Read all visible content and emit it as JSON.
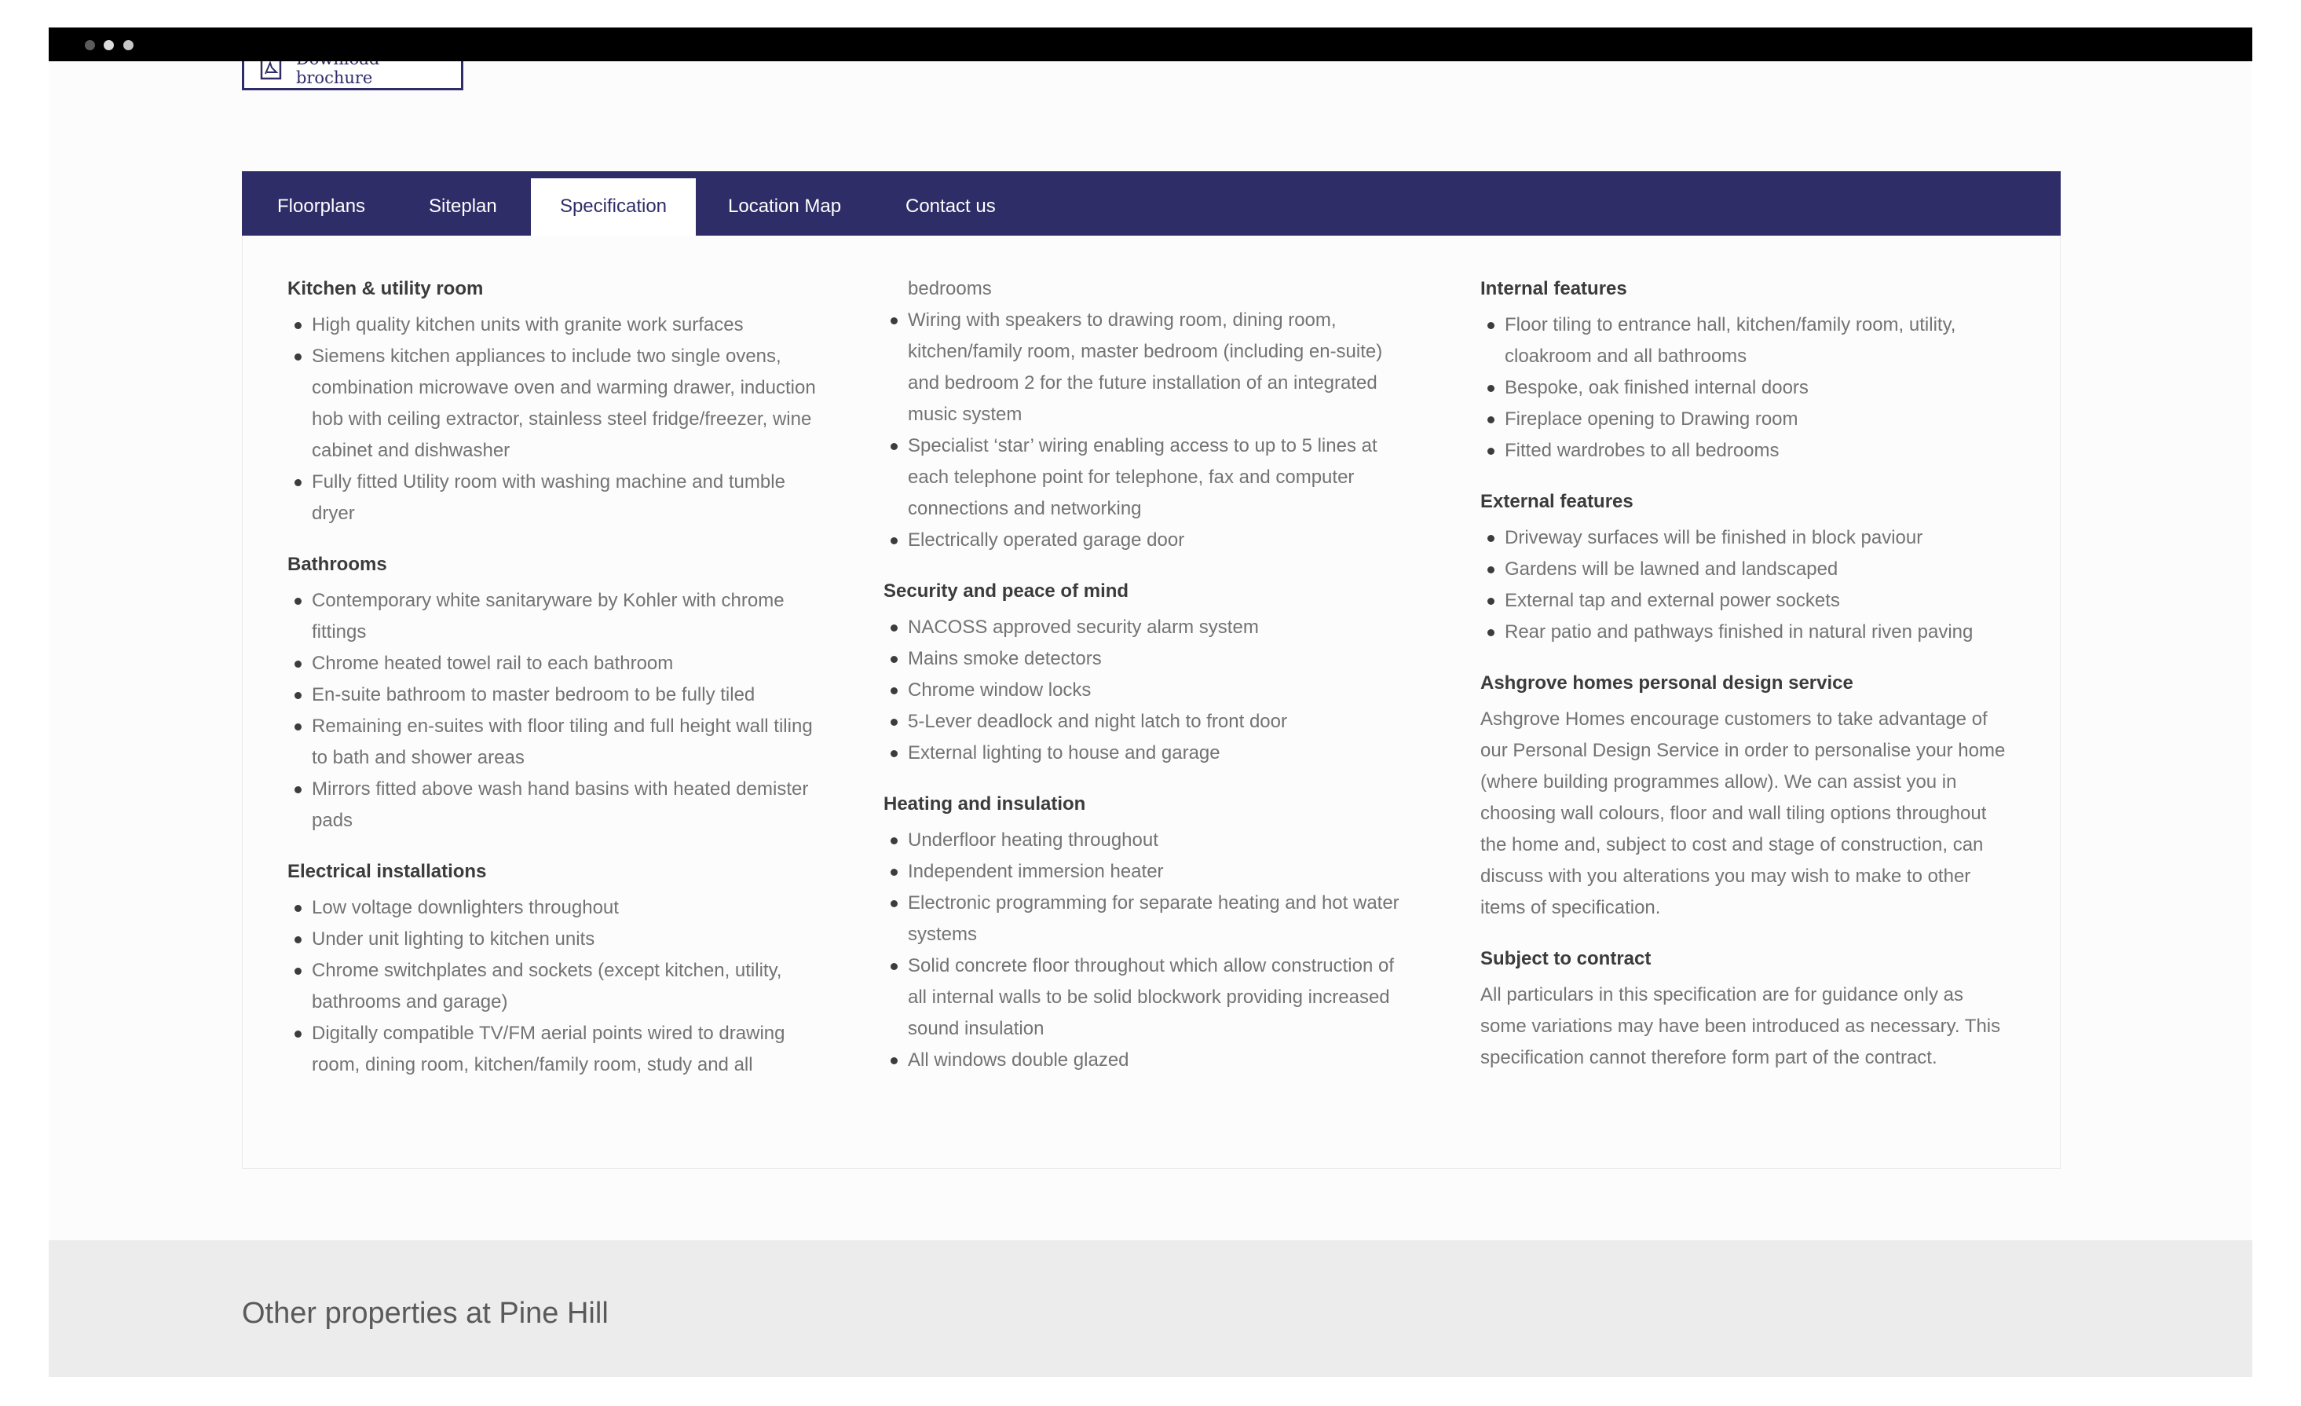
{
  "brochure": {
    "label": "Download brochure"
  },
  "top_cutoff_item": "Fitted wardrobes to all bedrooms",
  "tabs": [
    {
      "label": "Floorplans"
    },
    {
      "label": "Siteplan"
    },
    {
      "label": "Specification"
    },
    {
      "label": "Location Map"
    },
    {
      "label": "Contact us"
    }
  ],
  "active_tab": "Specification",
  "spec": {
    "kitchen": {
      "title": "Kitchen & utility room",
      "items": [
        "High quality kitchen units with granite work surfaces",
        "Siemens kitchen appliances to include two single ovens, combination microwave oven and warming drawer, induction hob with ceiling extractor, stainless steel fridge/freezer, wine cabinet and dishwasher",
        "Fully fitted Utility room with washing machine and tumble dryer"
      ]
    },
    "bathrooms": {
      "title": "Bathrooms",
      "items": [
        "Contemporary white sanitaryware by Kohler with chrome fittings",
        "Chrome heated towel rail to each bathroom",
        "En-suite bathroom to master bedroom to be fully tiled",
        "Remaining en-suites with floor tiling and full height wall tiling to bath and shower areas",
        "Mirrors fitted above wash hand basins with heated demister pads"
      ]
    },
    "electrical": {
      "title": "Electrical installations",
      "items": [
        "Low voltage downlighters throughout",
        "Under unit lighting to kitchen units",
        "Chrome switchplates and sockets (except kitchen, utility, bathrooms and garage)",
        "Digitally compatible TV/FM aerial points wired to drawing room, dining room, kitchen/family room, study and all"
      ],
      "continued": "bedrooms",
      "items_cont": [
        "Wiring with speakers to drawing room, dining room, kitchen/family room, master bedroom (including en-suite) and bedroom 2 for the future installation of an integrated music system",
        "Specialist ‘star’ wiring enabling access to up to 5 lines at each telephone point for telephone, fax and computer connections and networking",
        "Electrically operated garage door"
      ]
    },
    "security": {
      "title": "Security and peace of mind",
      "items": [
        "NACOSS approved security alarm system",
        "Mains smoke detectors",
        "Chrome window locks",
        "5-Lever deadlock and night latch to front door",
        "External lighting to house and garage"
      ]
    },
    "heating": {
      "title": "Heating and insulation",
      "items": [
        "Underfloor heating throughout",
        "Independent immersion heater",
        "Electronic programming for separate heating and hot water systems",
        "Solid concrete floor throughout which allow construction of all internal walls to be solid blockwork providing increased sound insulation",
        "All windows double glazed"
      ]
    },
    "internal": {
      "title": "Internal features",
      "items": [
        "Floor tiling to entrance hall, kitchen/family room, utility, cloakroom and all bathrooms",
        "Bespoke, oak finished internal doors",
        "Fireplace opening to Drawing room",
        "Fitted wardrobes to all bedrooms"
      ]
    },
    "external": {
      "title": "External features",
      "items": [
        "Driveway surfaces will be finished in block paviour",
        "Gardens will be lawned and landscaped",
        "External tap and external power sockets",
        "Rear patio and pathways finished in natural riven paving"
      ]
    },
    "design": {
      "title": "Ashgrove homes personal design service",
      "text": "Ashgrove Homes encourage customers to take advantage of our Personal Design Service in order to personalise your home (where building programmes allow). We can assist you in choosing wall colours, floor and wall tiling options throughout the home and, subject to cost and stage of construction, can discuss with you alterations you may wish to make to other items of specification."
    },
    "contract": {
      "title": "Subject to contract",
      "text": "All particulars in this specification are for guidance only as some variations may have been introduced as necessary. This specification cannot therefore form part of the contract."
    }
  },
  "footer": {
    "title": "Other properties at Pine Hill"
  },
  "colors": {
    "brand": "#2f2d68",
    "footer_bg": "#ececec"
  }
}
